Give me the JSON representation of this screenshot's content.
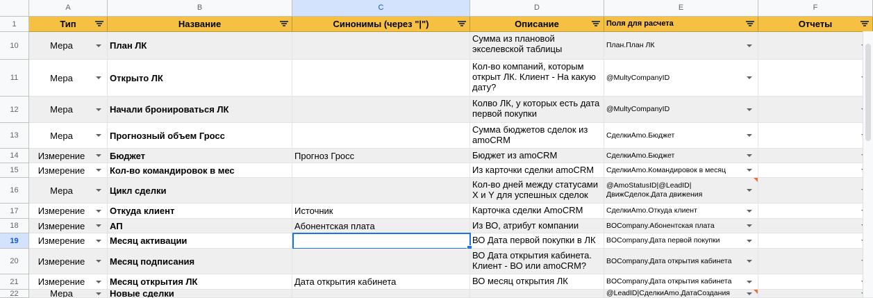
{
  "columns": [
    "A",
    "B",
    "C",
    "D",
    "E",
    "F"
  ],
  "selected_column": "C",
  "header_row_number": "1",
  "headers": [
    "Тип",
    "Название",
    "Синонимы (через \"|\")",
    "Описание",
    "Поля для расчета",
    "Отчеты"
  ],
  "rows": [
    {
      "num": "10",
      "type": "Мера",
      "name": "План ЛК",
      "syn": "",
      "desc": "Сумма из плановой экселевской таблицы",
      "fields": "План.План ЛК"
    },
    {
      "num": "11",
      "type": "Мера",
      "name": "Открыто ЛК",
      "syn": "",
      "desc": "Кол-во компаний, которым открыт ЛК. Клиент - На какую дату?",
      "fields": "@MultyCompanyID"
    },
    {
      "num": "12",
      "type": "Мера",
      "name": "Начали бронироваться ЛК",
      "syn": "",
      "desc": "Колво ЛК, у которых есть дата первой покупки",
      "fields": "@MultyCompanyID"
    },
    {
      "num": "13",
      "type": "Мера",
      "name": "Прогнозный объем Гросс",
      "syn": "",
      "desc": "Сумма бюджетов сделок из amoCRM",
      "fields": "СделкиAmo.Бюджет"
    },
    {
      "num": "14",
      "type": "Измерение",
      "name": "Бюджет",
      "syn": "Прогноз Гросс",
      "desc": "Бюджет из amoCRM",
      "fields": "СделкиAmo.Бюджет"
    },
    {
      "num": "15",
      "type": "Измерение",
      "name": "Кол-во командировок в мес",
      "syn": "",
      "desc": "Из карточки сделки amoCRM",
      "fields": "СделкиAmo.Командировок в месяц"
    },
    {
      "num": "16",
      "type": "Мера",
      "name": "Цикл сделки",
      "syn": "",
      "desc": "Кол-во дней между статусами X и Y для успешных сделок",
      "fields": "@AmoStatusID|@LeadID|ДвижСделок.Дата движения"
    },
    {
      "num": "17",
      "type": "Измерение",
      "name": "Откуда клиент",
      "syn": "Источник",
      "desc": "Карточка сделки AmoCRM",
      "fields": "СделкиAmo.Откуда клиент"
    },
    {
      "num": "18",
      "type": "Измерение",
      "name": "АП",
      "syn": "Абонентская плата",
      "desc": "Из ВО, атрибут компании",
      "fields": "BOCompany.Абонентская плата"
    },
    {
      "num": "19",
      "type": "Измерение",
      "name": "Месяц активации",
      "syn": "",
      "desc": "ВО Дата первой покупки в ЛК",
      "fields": "BOCompany.Дата первой покупки"
    },
    {
      "num": "20",
      "type": "Измерение",
      "name": "Месяц подписания",
      "syn": "",
      "desc": "ВО Дата открытия кабинета. Клиент - ВО или amoCRM?",
      "fields": "BOCompany.Дата открытия кабинета"
    },
    {
      "num": "21",
      "type": "Измерение",
      "name": "Месяц открытия ЛК",
      "syn": "Дата открытия кабинета",
      "desc": "ВО месяц открытия ЛК",
      "fields": "BOCompany.Дата открытия кабинета"
    },
    {
      "num": "22",
      "type": "Мера",
      "name": "Новые сделки",
      "syn": "",
      "desc": "",
      "fields": "@LeadID|СделкиAmo.ДатаСоздания"
    }
  ],
  "colors": {
    "header_bg": "#f6c142",
    "selection": "#1a73e8",
    "note": "#e8703a",
    "row_gray": "#efefef"
  }
}
